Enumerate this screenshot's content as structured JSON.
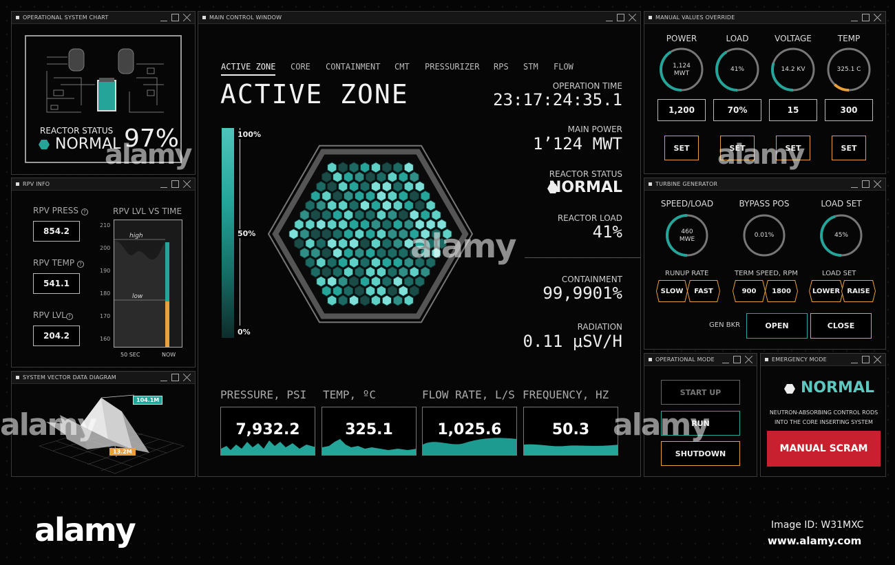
{
  "colors": {
    "accent_teal": "#25a59a",
    "accent_orange": "#e9a03a",
    "danger_red": "#c8202e"
  },
  "windows": {
    "op_chart": {
      "title": "OPERATIONAL SYSTEM CHART",
      "reactor_status_label": "REACTOR STATUS",
      "status": "NORMAL",
      "percent": "97%"
    },
    "rpv": {
      "title": "RPV INFO",
      "press_label": "RPV PRESS",
      "press_value": "854.2",
      "temp_label": "RPV TEMP",
      "temp_value": "541.1",
      "lvl_label": "RPV LVL",
      "lvl_value": "204.2",
      "chart_title": "RPV LVL VS TIME",
      "high_label": "high",
      "low_label": "low",
      "x_start": "50 SEC",
      "x_end": "NOW"
    },
    "vector": {
      "title": "SYSTEM VECTOR DATA DIAGRAM",
      "callout_a": "104.1M",
      "callout_b": "13.2M"
    },
    "main": {
      "title": "MAIN CONTROL WINDOW",
      "tabs": [
        "ACTIVE ZONE",
        "CORE",
        "CONTAINMENT",
        "CMT",
        "PRESSURIZER",
        "RPS",
        "STM",
        "FLOW"
      ],
      "active_tab": 0,
      "heading": "ACTIVE ZONE",
      "scale_top": "100%",
      "scale_mid": "50%",
      "scale_bottom": "0%",
      "operation_time_label": "OPERATION TIME",
      "operation_time": "23:17:24:35.1",
      "main_power_label": "MAIN POWER",
      "main_power": "1’124 MWT",
      "reactor_status_label": "REACTOR STATUS",
      "reactor_status": "NORMAL",
      "reactor_load_label": "REACTOR LOAD",
      "reactor_load": "41%",
      "containment_label": "CONTAINMENT",
      "containment": "99,9901%",
      "radiation_label": "RADIATION",
      "radiation": "0.11 μSV/H",
      "metrics": [
        {
          "label": "PRESSURE, PSI",
          "value": "7,932.2"
        },
        {
          "label": "TEMP, ºC",
          "value": "325.1"
        },
        {
          "label": "FLOW RATE, L/S",
          "value": "1,025.6"
        },
        {
          "label": "FREQUENCY, HZ",
          "value": "50.3"
        }
      ]
    },
    "manual": {
      "title": "MANUAL VALUES OVERRIDE",
      "gauges": [
        {
          "label": "POWER",
          "value": "1,124",
          "unit": "MWT",
          "input": "1,200",
          "fraction": 0.41,
          "color": "#25a59a"
        },
        {
          "label": "LOAD",
          "value": "41%",
          "unit": "",
          "input": "70%",
          "fraction": 0.41,
          "color": "#25a59a"
        },
        {
          "label": "VOLTAGE",
          "value": "14.2 KV",
          "unit": "",
          "input": "15",
          "fraction": 0.3,
          "color": "#25a59a"
        },
        {
          "label": "TEMP",
          "value": "325.1 C",
          "unit": "",
          "input": "300",
          "fraction": 0.12,
          "color": "#e9a03a"
        }
      ],
      "set_label": "SET"
    },
    "turbine": {
      "title": "TURBINE GENERATOR",
      "gauges": [
        {
          "label": "SPEED/LOAD",
          "value": "460",
          "unit": "MWE",
          "fraction": 0.5
        },
        {
          "label": "BYPASS POS",
          "value": "0.01%",
          "unit": "",
          "fraction": 0.0
        },
        {
          "label": "LOAD SET",
          "value": "45%",
          "unit": "",
          "fraction": 0.45
        }
      ],
      "runup_label": "RUNUP RATE",
      "runup_options": [
        "SLOW",
        "FAST"
      ],
      "term_label": "TERM SPEED, RPM",
      "term_options": [
        "900",
        "1800"
      ],
      "loadset_label": "LOAD SET",
      "loadset_options": [
        "LOWER",
        "RAISE"
      ],
      "gen_bkr_label": "GEN BKR",
      "open_label": "OPEN",
      "close_label": "CLOSE"
    },
    "opmode": {
      "title": "OPERATIONAL MODE",
      "start_label": "START UP",
      "run_label": "RUN",
      "shutdown_label": "SHUTDOWN"
    },
    "emergency": {
      "title": "EMERGENCY MODE",
      "status": "NORMAL",
      "desc_line1": "NEUTRON-ABSORBING CONTROL RODS",
      "desc_line2": "INTO THE CORE INSERTING SYSTEM",
      "scram_label": "MANUAL SCRAM"
    }
  },
  "watermark": {
    "brand": "alamy",
    "image_id": "Image ID: W31MXC",
    "url": "www.alamy.com"
  }
}
